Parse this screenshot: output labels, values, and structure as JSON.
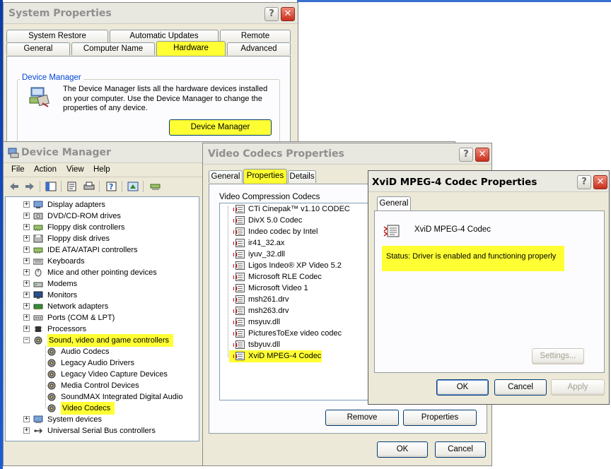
{
  "system_properties": {
    "title": "System Properties",
    "tabs_row1": [
      "System Restore",
      "Automatic Updates",
      "Remote"
    ],
    "tabs_row2": [
      "General",
      "Computer Name",
      "Hardware",
      "Advanced"
    ],
    "group_label": "Device Manager",
    "description": "The Device Manager lists all the hardware devices installed on your computer. Use the Device Manager to change the properties of any device.",
    "button": "Device Manager"
  },
  "device_manager": {
    "title": "Device Manager",
    "menu": [
      "File",
      "Action",
      "View",
      "Help"
    ],
    "tree": [
      {
        "label": "Display adapters",
        "icon": "display-icon"
      },
      {
        "label": "DVD/CD-ROM drives",
        "icon": "cdrom-icon"
      },
      {
        "label": "Floppy disk controllers",
        "icon": "controller-icon"
      },
      {
        "label": "Floppy disk drives",
        "icon": "floppy-icon"
      },
      {
        "label": "IDE ATA/ATAPI controllers",
        "icon": "controller-icon"
      },
      {
        "label": "Keyboards",
        "icon": "keyboard-icon"
      },
      {
        "label": "Mice and other pointing devices",
        "icon": "mouse-icon"
      },
      {
        "label": "Modems",
        "icon": "modem-icon"
      },
      {
        "label": "Monitors",
        "icon": "monitor-icon"
      },
      {
        "label": "Network adapters",
        "icon": "network-icon"
      },
      {
        "label": "Ports (COM & LPT)",
        "icon": "port-icon"
      },
      {
        "label": "Processors",
        "icon": "processor-icon"
      },
      {
        "label": "Sound, video and game controllers",
        "icon": "sound-icon"
      },
      {
        "label": "Audio Codecs",
        "icon": "sound-icon"
      },
      {
        "label": "Legacy Audio Drivers",
        "icon": "sound-icon"
      },
      {
        "label": "Legacy Video Capture Devices",
        "icon": "sound-icon"
      },
      {
        "label": "Media Control Devices",
        "icon": "sound-icon"
      },
      {
        "label": "SoundMAX Integrated Digital Audio",
        "icon": "sound-icon"
      },
      {
        "label": "Video Codecs",
        "icon": "sound-icon"
      },
      {
        "label": "System devices",
        "icon": "computer-icon"
      },
      {
        "label": "Universal Serial Bus controllers",
        "icon": "usb-icon"
      }
    ]
  },
  "video_codecs": {
    "title": "Video Codecs Properties",
    "tabs": [
      "General",
      "Properties",
      "Details"
    ],
    "list_label": "Video Compression Codecs",
    "codecs": [
      "CTi Cinepak™ v1.10 CODEC",
      "DivX 5.0 Codec",
      "Indeo codec by Intel",
      "ir41_32.ax",
      "iyuv_32.dll",
      "Ligos Indeo® XP Video 5.2",
      "Microsoft RLE Codec",
      "Microsoft Video 1",
      "msh261.drv",
      "msh263.drv",
      "msyuv.dll",
      "PicturesToExe video codec",
      "tsbyuv.dll",
      "XviD MPEG-4 Codec"
    ],
    "remove": "Remove",
    "properties": "Properties",
    "ok": "OK",
    "cancel": "Cancel"
  },
  "xvid": {
    "title": "XviD MPEG-4 Codec Properties",
    "tab": "General",
    "name": "XviD MPEG-4 Codec",
    "status": "Status: Driver is enabled and functioning properly",
    "settings": "Settings...",
    "ok": "OK",
    "cancel": "Cancel",
    "apply": "Apply"
  },
  "colors": {
    "highlight": "#ffff33",
    "xp_blue": "#0046d5"
  }
}
